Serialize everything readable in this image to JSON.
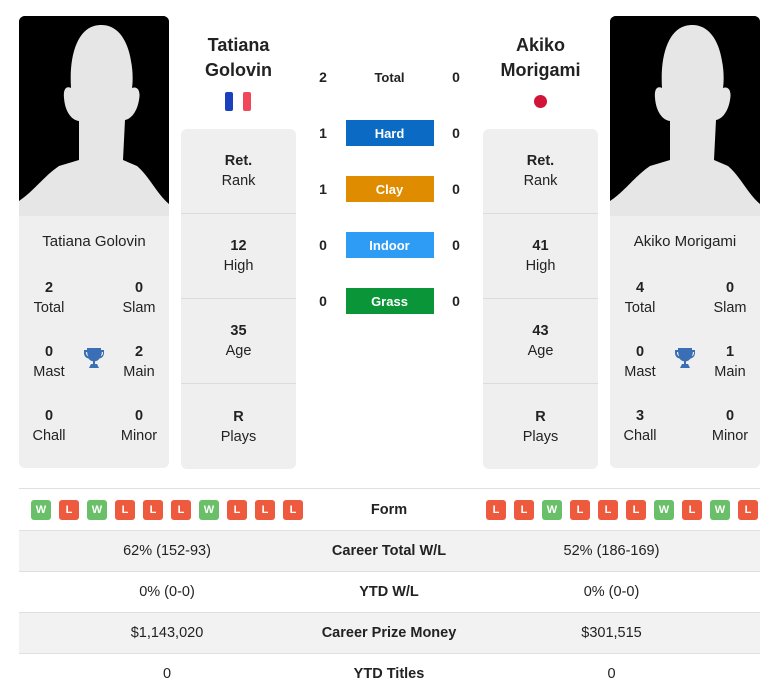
{
  "player1": {
    "name_line1": "Tatiana",
    "name_line2": "Golovin",
    "full_name": "Tatiana Golovin",
    "flag": "france-flag",
    "titles": {
      "total": "2",
      "slam": "0",
      "mast": "0",
      "main": "2",
      "chall": "0",
      "minor": "0"
    },
    "rank": {
      "value": "Ret.",
      "label": "Rank"
    },
    "high": {
      "value": "12",
      "label": "High"
    },
    "age": {
      "value": "35",
      "label": "Age"
    },
    "plays": {
      "value": "R",
      "label": "Plays"
    },
    "form": [
      "W",
      "L",
      "W",
      "L",
      "L",
      "L",
      "W",
      "L",
      "L",
      "L"
    ]
  },
  "player2": {
    "name_line1": "Akiko",
    "name_line2": "Morigami",
    "full_name": "Akiko Morigami",
    "flag": "japan-flag",
    "titles": {
      "total": "4",
      "slam": "0",
      "mast": "0",
      "main": "1",
      "chall": "3",
      "minor": "0"
    },
    "rank": {
      "value": "Ret.",
      "label": "Rank"
    },
    "high": {
      "value": "41",
      "label": "High"
    },
    "age": {
      "value": "43",
      "label": "Age"
    },
    "plays": {
      "value": "R",
      "label": "Plays"
    },
    "form": [
      "L",
      "L",
      "W",
      "L",
      "L",
      "L",
      "W",
      "L",
      "W",
      "L"
    ]
  },
  "labels": {
    "total": "Total",
    "slam": "Slam",
    "mast": "Mast",
    "main": "Main",
    "chall": "Chall",
    "minor": "Minor"
  },
  "h2h": [
    {
      "label": "Total",
      "p1": "2",
      "p2": "0",
      "color": null
    },
    {
      "label": "Hard",
      "p1": "1",
      "p2": "0",
      "color": "#0b6bc4"
    },
    {
      "label": "Clay",
      "p1": "1",
      "p2": "0",
      "color": "#df8c00"
    },
    {
      "label": "Indoor",
      "p1": "0",
      "p2": "0",
      "color": "#2e9cf5"
    },
    {
      "label": "Grass",
      "p1": "0",
      "p2": "0",
      "color": "#0a9638"
    }
  ],
  "comparison": {
    "form_label": "Form",
    "rows": [
      {
        "label": "Career Total W/L",
        "p1": "62% (152-93)",
        "p2": "52% (186-169)"
      },
      {
        "label": "YTD W/L",
        "p1": "0% (0-0)",
        "p2": "0% (0-0)"
      },
      {
        "label": "Career Prize Money",
        "p1": "$1,143,020",
        "p2": "$301,515"
      },
      {
        "label": "YTD Titles",
        "p1": "0",
        "p2": "0"
      }
    ]
  },
  "colors": {
    "win": "#6abf69",
    "loss": "#ee5a3e",
    "trophy": "#3a6fb5"
  }
}
